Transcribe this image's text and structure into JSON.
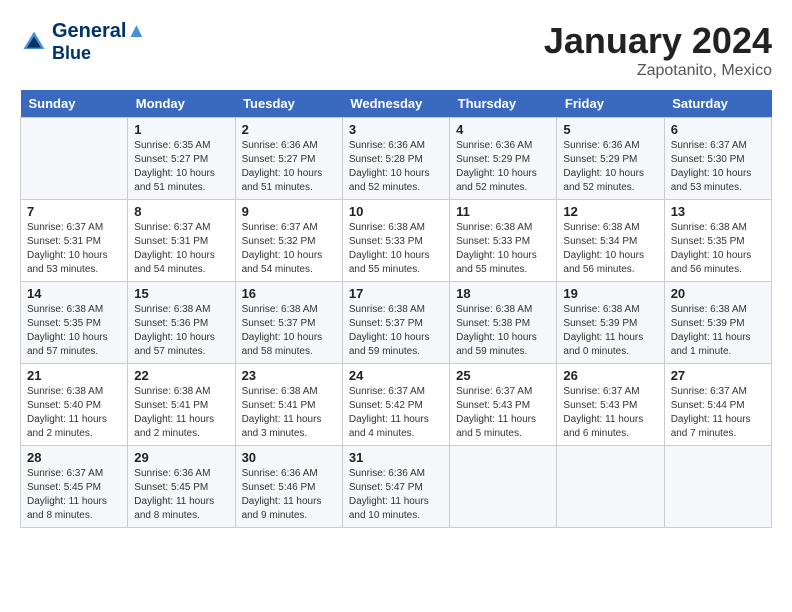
{
  "header": {
    "logo_line1": "General",
    "logo_line2": "Blue",
    "month_title": "January 2024",
    "location": "Zapotanito, Mexico"
  },
  "weekdays": [
    "Sunday",
    "Monday",
    "Tuesday",
    "Wednesday",
    "Thursday",
    "Friday",
    "Saturday"
  ],
  "weeks": [
    [
      {
        "day": "",
        "sunrise": "",
        "sunset": "",
        "daylight": ""
      },
      {
        "day": "1",
        "sunrise": "Sunrise: 6:35 AM",
        "sunset": "Sunset: 5:27 PM",
        "daylight": "Daylight: 10 hours and 51 minutes."
      },
      {
        "day": "2",
        "sunrise": "Sunrise: 6:36 AM",
        "sunset": "Sunset: 5:27 PM",
        "daylight": "Daylight: 10 hours and 51 minutes."
      },
      {
        "day": "3",
        "sunrise": "Sunrise: 6:36 AM",
        "sunset": "Sunset: 5:28 PM",
        "daylight": "Daylight: 10 hours and 52 minutes."
      },
      {
        "day": "4",
        "sunrise": "Sunrise: 6:36 AM",
        "sunset": "Sunset: 5:29 PM",
        "daylight": "Daylight: 10 hours and 52 minutes."
      },
      {
        "day": "5",
        "sunrise": "Sunrise: 6:36 AM",
        "sunset": "Sunset: 5:29 PM",
        "daylight": "Daylight: 10 hours and 52 minutes."
      },
      {
        "day": "6",
        "sunrise": "Sunrise: 6:37 AM",
        "sunset": "Sunset: 5:30 PM",
        "daylight": "Daylight: 10 hours and 53 minutes."
      }
    ],
    [
      {
        "day": "7",
        "sunrise": "Sunrise: 6:37 AM",
        "sunset": "Sunset: 5:31 PM",
        "daylight": "Daylight: 10 hours and 53 minutes."
      },
      {
        "day": "8",
        "sunrise": "Sunrise: 6:37 AM",
        "sunset": "Sunset: 5:31 PM",
        "daylight": "Daylight: 10 hours and 54 minutes."
      },
      {
        "day": "9",
        "sunrise": "Sunrise: 6:37 AM",
        "sunset": "Sunset: 5:32 PM",
        "daylight": "Daylight: 10 hours and 54 minutes."
      },
      {
        "day": "10",
        "sunrise": "Sunrise: 6:38 AM",
        "sunset": "Sunset: 5:33 PM",
        "daylight": "Daylight: 10 hours and 55 minutes."
      },
      {
        "day": "11",
        "sunrise": "Sunrise: 6:38 AM",
        "sunset": "Sunset: 5:33 PM",
        "daylight": "Daylight: 10 hours and 55 minutes."
      },
      {
        "day": "12",
        "sunrise": "Sunrise: 6:38 AM",
        "sunset": "Sunset: 5:34 PM",
        "daylight": "Daylight: 10 hours and 56 minutes."
      },
      {
        "day": "13",
        "sunrise": "Sunrise: 6:38 AM",
        "sunset": "Sunset: 5:35 PM",
        "daylight": "Daylight: 10 hours and 56 minutes."
      }
    ],
    [
      {
        "day": "14",
        "sunrise": "Sunrise: 6:38 AM",
        "sunset": "Sunset: 5:35 PM",
        "daylight": "Daylight: 10 hours and 57 minutes."
      },
      {
        "day": "15",
        "sunrise": "Sunrise: 6:38 AM",
        "sunset": "Sunset: 5:36 PM",
        "daylight": "Daylight: 10 hours and 57 minutes."
      },
      {
        "day": "16",
        "sunrise": "Sunrise: 6:38 AM",
        "sunset": "Sunset: 5:37 PM",
        "daylight": "Daylight: 10 hours and 58 minutes."
      },
      {
        "day": "17",
        "sunrise": "Sunrise: 6:38 AM",
        "sunset": "Sunset: 5:37 PM",
        "daylight": "Daylight: 10 hours and 59 minutes."
      },
      {
        "day": "18",
        "sunrise": "Sunrise: 6:38 AM",
        "sunset": "Sunset: 5:38 PM",
        "daylight": "Daylight: 10 hours and 59 minutes."
      },
      {
        "day": "19",
        "sunrise": "Sunrise: 6:38 AM",
        "sunset": "Sunset: 5:39 PM",
        "daylight": "Daylight: 11 hours and 0 minutes."
      },
      {
        "day": "20",
        "sunrise": "Sunrise: 6:38 AM",
        "sunset": "Sunset: 5:39 PM",
        "daylight": "Daylight: 11 hours and 1 minute."
      }
    ],
    [
      {
        "day": "21",
        "sunrise": "Sunrise: 6:38 AM",
        "sunset": "Sunset: 5:40 PM",
        "daylight": "Daylight: 11 hours and 2 minutes."
      },
      {
        "day": "22",
        "sunrise": "Sunrise: 6:38 AM",
        "sunset": "Sunset: 5:41 PM",
        "daylight": "Daylight: 11 hours and 2 minutes."
      },
      {
        "day": "23",
        "sunrise": "Sunrise: 6:38 AM",
        "sunset": "Sunset: 5:41 PM",
        "daylight": "Daylight: 11 hours and 3 minutes."
      },
      {
        "day": "24",
        "sunrise": "Sunrise: 6:37 AM",
        "sunset": "Sunset: 5:42 PM",
        "daylight": "Daylight: 11 hours and 4 minutes."
      },
      {
        "day": "25",
        "sunrise": "Sunrise: 6:37 AM",
        "sunset": "Sunset: 5:43 PM",
        "daylight": "Daylight: 11 hours and 5 minutes."
      },
      {
        "day": "26",
        "sunrise": "Sunrise: 6:37 AM",
        "sunset": "Sunset: 5:43 PM",
        "daylight": "Daylight: 11 hours and 6 minutes."
      },
      {
        "day": "27",
        "sunrise": "Sunrise: 6:37 AM",
        "sunset": "Sunset: 5:44 PM",
        "daylight": "Daylight: 11 hours and 7 minutes."
      }
    ],
    [
      {
        "day": "28",
        "sunrise": "Sunrise: 6:37 AM",
        "sunset": "Sunset: 5:45 PM",
        "daylight": "Daylight: 11 hours and 8 minutes."
      },
      {
        "day": "29",
        "sunrise": "Sunrise: 6:36 AM",
        "sunset": "Sunset: 5:45 PM",
        "daylight": "Daylight: 11 hours and 8 minutes."
      },
      {
        "day": "30",
        "sunrise": "Sunrise: 6:36 AM",
        "sunset": "Sunset: 5:46 PM",
        "daylight": "Daylight: 11 hours and 9 minutes."
      },
      {
        "day": "31",
        "sunrise": "Sunrise: 6:36 AM",
        "sunset": "Sunset: 5:47 PM",
        "daylight": "Daylight: 11 hours and 10 minutes."
      },
      {
        "day": "",
        "sunrise": "",
        "sunset": "",
        "daylight": ""
      },
      {
        "day": "",
        "sunrise": "",
        "sunset": "",
        "daylight": ""
      },
      {
        "day": "",
        "sunrise": "",
        "sunset": "",
        "daylight": ""
      }
    ]
  ]
}
